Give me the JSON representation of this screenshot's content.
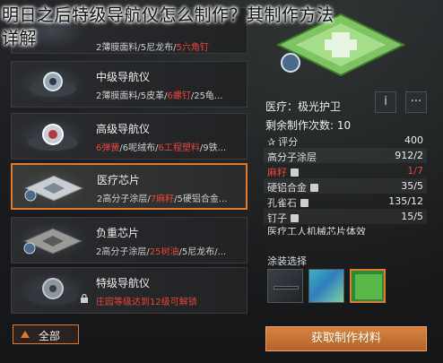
{
  "page_title": {
    "line1": "明日之后特级导航仪怎么制作？其制作方法",
    "line2": "详解"
  },
  "list": [
    {
      "name": "",
      "mats_plain": "2薄膜面料/5尼龙布/",
      "mats_highlight": "5六角钉",
      "mats_rest": "",
      "state": "partial"
    },
    {
      "name": "中级导航仪",
      "mats_plain": "2薄膜面料/5皮革/",
      "mats_highlight": "6螺钉",
      "mats_rest": "/25龟...",
      "state": "normal"
    },
    {
      "name": "高级导航仪",
      "mats_highlight": "6弹簧",
      "mats_plain": "/6呢绒布/",
      "mats_highlight2": "6工程塑料",
      "mats_rest": "/9铁...",
      "state": "normal"
    },
    {
      "name": "医疗芯片",
      "mats_plain": "2高分子涂层/",
      "mats_highlight": "7麻籽",
      "mats_rest": "/5硬铝合金...",
      "state": "selected"
    },
    {
      "name": "负重芯片",
      "mats_plain": "2高分子涂层/",
      "mats_highlight": "25树油",
      "mats_rest": "/5尼龙布/...",
      "state": "normal"
    },
    {
      "name": "特级导航仪",
      "locked_text": "庄园等级达到12级可解锁",
      "state": "locked"
    }
  ],
  "filter_button": {
    "label": "全部"
  },
  "detail": {
    "title": "医疗：极光护卫",
    "info_label": "i",
    "more_label": "···",
    "count_label": "剩余制作次数:",
    "count_value": "10",
    "rows": [
      {
        "key": "评分",
        "value": "400",
        "style": "normal",
        "star": true
      },
      {
        "key": "高分子涂层",
        "value": "912/2",
        "style": "normal"
      },
      {
        "key": "麻籽",
        "value": "1/7",
        "style": "red",
        "bang": true
      },
      {
        "key": "硬铝合金",
        "value": "35/5",
        "style": "normal",
        "bang": true
      },
      {
        "key": "孔雀石",
        "value": "135/12",
        "style": "normal",
        "bang": true
      },
      {
        "key": "钉子",
        "value": "15/5",
        "style": "normal",
        "bang": true
      },
      {
        "key": "医疗工人机械芯片体效",
        "value": "",
        "style": "normal"
      }
    ],
    "coating_label": "涂装选择",
    "action_button": "获取制作材料"
  },
  "colors": {
    "accent": "#e07a32",
    "highlight_red": "#e8453a",
    "background": "#1b1c1d"
  }
}
